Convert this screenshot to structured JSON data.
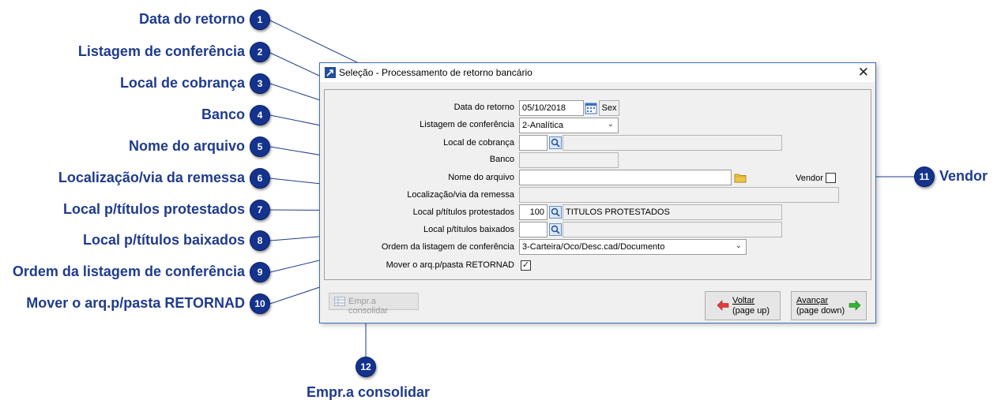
{
  "callouts": [
    {
      "num": "1",
      "label": "Data do retorno"
    },
    {
      "num": "2",
      "label": "Listagem de conferência"
    },
    {
      "num": "3",
      "label": "Local de cobrança"
    },
    {
      "num": "4",
      "label": "Banco"
    },
    {
      "num": "5",
      "label": "Nome do arquivo"
    },
    {
      "num": "6",
      "label": "Localização/via da remessa"
    },
    {
      "num": "7",
      "label": "Local p/títulos protestados"
    },
    {
      "num": "8",
      "label": "Local p/títulos baixados"
    },
    {
      "num": "9",
      "label": "Ordem da listagem de conferência"
    },
    {
      "num": "10",
      "label": "Mover o arq.p/pasta RETORNAD"
    },
    {
      "num": "11",
      "label": "Vendor"
    },
    {
      "num": "12",
      "label": "Empr.a consolidar"
    }
  ],
  "window": {
    "title": "Seleção - Processamento de retorno bancário",
    "close": "✕"
  },
  "form": {
    "data_retorno": {
      "label": "Data do retorno",
      "value": "05/10/2018",
      "weekday": "Sex"
    },
    "listagem": {
      "label": "Listagem de conferência",
      "value": "2-Analítica"
    },
    "local_cobranca": {
      "label": "Local de cobrança",
      "code": "",
      "desc": ""
    },
    "banco": {
      "label": "Banco",
      "value": ""
    },
    "nome_arquivo": {
      "label": "Nome do arquivo",
      "value": ""
    },
    "vendor": {
      "label": "Vendor",
      "checked": false
    },
    "localizacao": {
      "label": "Localização/via da remessa",
      "value": ""
    },
    "protestados": {
      "label": "Local p/títulos protestados",
      "code": "100",
      "desc": "TITULOS PROTESTADOS"
    },
    "baixados": {
      "label": "Local p/títulos baixados",
      "code": "",
      "desc": ""
    },
    "ordem": {
      "label": "Ordem da listagem de conferência",
      "value": "3-Carteira/Oco/Desc.cad/Documento"
    },
    "mover": {
      "label": "Mover o arq.p/pasta RETORNAD",
      "checked": true,
      "mark": "✓"
    }
  },
  "buttons": {
    "empr_consolidar": "Empr.a consolidar",
    "voltar": {
      "line1": "Voltar",
      "line2": "(page up)"
    },
    "avancar": {
      "line1": "Avançar",
      "line2": "(page down)"
    }
  },
  "colors": {
    "callout_text": "#1f3b8c",
    "badge": "#14338f",
    "window_border": "#3c6fb3",
    "arrow_red": "#e23b3b",
    "arrow_green": "#2fb52f"
  }
}
